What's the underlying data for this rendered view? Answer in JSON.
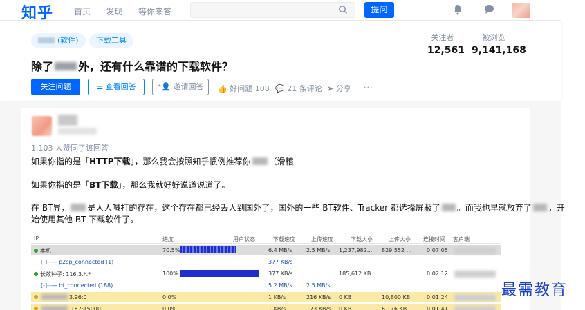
{
  "topbar": {
    "logo": "知乎",
    "nav": [
      "首页",
      "发现",
      "等你来答"
    ],
    "ask_label": "提问"
  },
  "question": {
    "tags": [
      "(软件)",
      "下载工具"
    ],
    "title_pre": "除了",
    "title_post": "外，还有什么靠谱的下载软件？",
    "stats": [
      {
        "label": "关注者",
        "value": "12,561"
      },
      {
        "label": "被浏览",
        "value": "9,141,168"
      }
    ],
    "buttons": {
      "follow": "关注问题",
      "view": "查看回答",
      "invite": "邀请回答"
    },
    "actions": {
      "good_question": "好问题 108",
      "comments": "21 条评论",
      "share": "分享",
      "more": "···"
    }
  },
  "answer": {
    "votes": "1,103 人赞同了该回答",
    "p1_a": "如果你指的是「",
    "p1_b": "HTTP下载",
    "p1_c": "」，那么我会按照知乎惯例推荐你",
    "p1_d": "（滑稽",
    "p2_a": "如果你指的是「",
    "p2_b": "BT下载",
    "p2_c": "」，那么我就好好说道说道了。",
    "p3_a": "在 BT界，",
    "p3_b": "是人人喊打的存在，这个存在都已经丢人到国外了，国外的一些 BT软件、Tracker 都选择屏蔽了",
    "p3_c": "。而我也早就放弃了",
    "p3_d": "，开",
    "p4": "始使用其他 BT 下载软件了。"
  },
  "table": {
    "headers": [
      "IP",
      "进度",
      "用户状态",
      "下载速度",
      "上传速度",
      "下载大小",
      "上传大小",
      "连接时间",
      "客户端"
    ],
    "rows": [
      {
        "ip": "本机",
        "progress": "70.5%",
        "down": "6.4 MB/s",
        "up": "2.5 MB/s",
        "dsize": "1,237,982...",
        "usize": "829,552 ...",
        "time": "0:07:05",
        "dot": "green",
        "bg": "#dcdcdc",
        "bar": 0.705
      },
      {
        "ip": "[-]----- p2sp_connected (1)",
        "progress": "",
        "down": "377 KB/s",
        "up": "",
        "dsize": "",
        "usize": "",
        "time": "",
        "dot": "",
        "bg": "#ffffff",
        "bar": 0,
        "link": true
      },
      {
        "ip": "长效种子: 116.3.*.*",
        "progress": "100%",
        "down": "377 KB/s",
        "up": "",
        "dsize": "185,612 KB",
        "usize": "",
        "time": "0:02:12",
        "dot": "green",
        "bg": "#ffffff",
        "bar": 1.0
      },
      {
        "ip": "[-]----- bt_connected (188)",
        "progress": "",
        "down": "5.2 MB/s",
        "up": "2.5 MB/s",
        "dsize": "",
        "usize": "",
        "time": "",
        "dot": "",
        "bg": "#ffffff",
        "bar": 0,
        "link": true
      },
      {
        "ip": "3.96:0",
        "progress": "0.0%",
        "down": "1 KB/s",
        "up": "216 KB/s",
        "dsize": "0 KB",
        "usize": "10,800 KB",
        "time": "0:01:24",
        "dot": "yellow",
        "bg": "#fbe9a6",
        "bar": 0
      },
      {
        "ip": ".167:15000",
        "progress": "0.0%",
        "down": "1 KB/s",
        "up": "173 KB/s",
        "dsize": "0 KB",
        "usize": "6,176 KB",
        "time": "0:01:41",
        "dot": "yellow",
        "bg": "#fbe9a6",
        "bar": 0
      }
    ]
  },
  "watermark": "最需教育",
  "colors": {
    "brand": "#0066ff",
    "link": "#0084ff",
    "muted": "#8590a6",
    "bar": "#1e2fd1"
  }
}
